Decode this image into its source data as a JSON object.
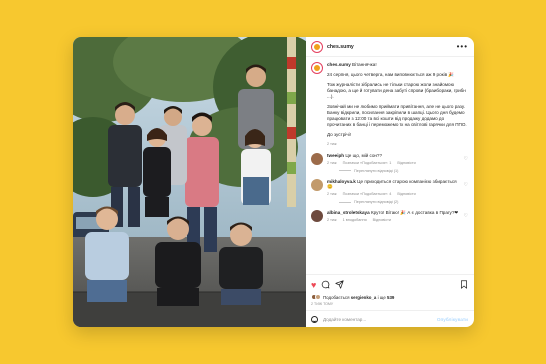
{
  "post": {
    "username": "ches.sumy",
    "more_icon": "more-horizontal-icon",
    "photo_alt": "Group photo of the ches.sumy team",
    "caption": {
      "greeting": "Вітаннячка!",
      "paragraphs": [
        "24 серпня, цього четверга, нам виповнюється аж 9 років 🎉",
        "Тож журналісти зібрались не тільки старою жоли знайомою банадою, а ще й готувати дена забуті спрови (браибораки, грибн ...).",
        "Зовнічай ми не любимо приймати привітання, але не цього разу. Банку відкрили, посилання закріпили в шапці. Цього дня будемо працювати з 12:00 та всі кошти від продажу додамо до прочитаних в банці і переможемо їх на світлові гарячки для ППО.",
        "До зустрічі!"
      ],
      "time": "2 тиж"
    },
    "comments": [
      {
        "username": "tweeiph",
        "text": "Це що, мій сон??",
        "time": "2 тиж",
        "likes": "Позначки «Подобається»: 1",
        "reply": "Відповісти",
        "view_replies": "Переглянути відповіді (1)",
        "avatar_color": "#9c6b4a"
      },
      {
        "username": "mikhaloyva.k",
        "text": "Це приходиться старою компанією збирається 😊",
        "time": "2 тиж",
        "likes": "Позначки «Подобається»: 4",
        "reply": "Відповісти",
        "view_replies": "Переглянути відповіді (2)",
        "avatar_color": "#c29a6b"
      },
      {
        "username": "albina_stroletskaya",
        "text": "Круто! Вітаю! 🎉 А є доставка в Прагу?❤",
        "time": "2 тиж",
        "likes": "1 вподобання",
        "reply": "Відповісти",
        "view_replies": "",
        "avatar_color": "#6e4a3e"
      }
    ],
    "actions": {
      "like_icon": "heart-icon",
      "comment_icon": "comment-icon",
      "share_icon": "share-icon",
      "save_icon": "bookmark-icon"
    },
    "likes": {
      "prefix": "Подобається",
      "user": "sergienko_a",
      "and": "і ще",
      "count": "539"
    },
    "posted_ago": "2 ТИЖ ТОМУ",
    "add_comment": {
      "placeholder": "Додайте коментар...",
      "publish_label": "Опублікувати",
      "emoji_icon": "emoji-smile-icon"
    }
  },
  "colors": {
    "background": "#f7c82f",
    "accent_like": "#ed4956",
    "publish_disabled": "#b3dbff"
  }
}
